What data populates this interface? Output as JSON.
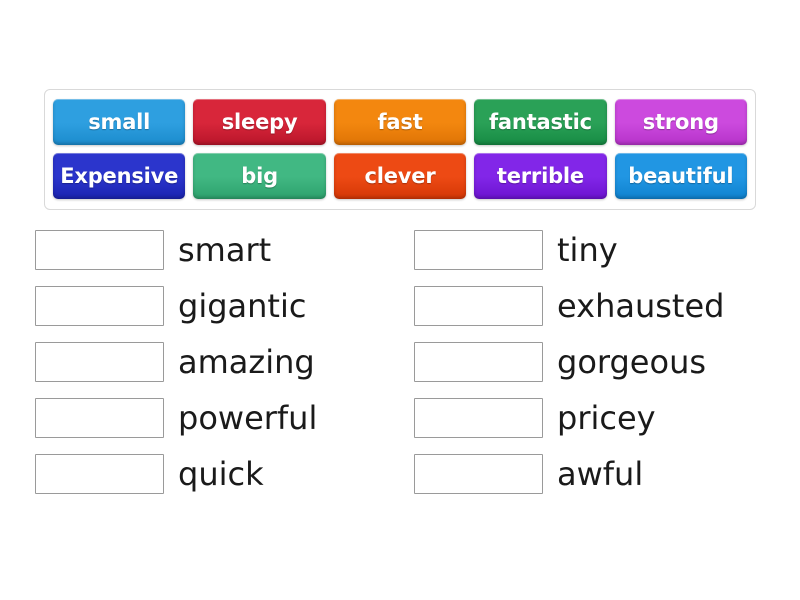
{
  "activity": {
    "type": "match-up-drag-and-drop",
    "background_color": "#ffffff"
  },
  "tile_tray": {
    "border_color": "#d9d9d9",
    "rows": [
      [
        {
          "label": "small",
          "color": "#2e9fe0",
          "color_dark": "#1b8bcc"
        },
        {
          "label": "sleepy",
          "color": "#d8263a",
          "color_dark": "#b8152a"
        },
        {
          "label": "fast",
          "color": "#f3870f",
          "color_dark": "#de7305"
        },
        {
          "label": "fantastic",
          "color": "#2aa157",
          "color_dark": "#168a43"
        },
        {
          "label": "strong",
          "color": "#cc4ade",
          "color_dark": "#b632c9"
        }
      ],
      [
        {
          "label": "Expensive",
          "color": "#2b35cc",
          "color_dark": "#1a23b0"
        },
        {
          "label": "big",
          "color": "#41b883",
          "color_dark": "#2da26d"
        },
        {
          "label": "clever",
          "color": "#ed4a14",
          "color_dark": "#d43706"
        },
        {
          "label": "terrible",
          "color": "#8226e8",
          "color_dark": "#6b13cf"
        },
        {
          "label": "beautiful",
          "color": "#2196e3",
          "color_dark": "#0f82cf"
        }
      ]
    ]
  },
  "answers": {
    "slot_placeholder": "",
    "left_column": [
      {
        "slot_value": "",
        "word": "smart"
      },
      {
        "slot_value": "",
        "word": "gigantic"
      },
      {
        "slot_value": "",
        "word": "amazing"
      },
      {
        "slot_value": "",
        "word": "powerful"
      },
      {
        "slot_value": "",
        "word": "quick"
      }
    ],
    "right_column": [
      {
        "slot_value": "",
        "word": "tiny"
      },
      {
        "slot_value": "",
        "word": "exhausted"
      },
      {
        "slot_value": "",
        "word": "gorgeous"
      },
      {
        "slot_value": "",
        "word": "pricey"
      },
      {
        "slot_value": "",
        "word": "awful"
      }
    ]
  }
}
